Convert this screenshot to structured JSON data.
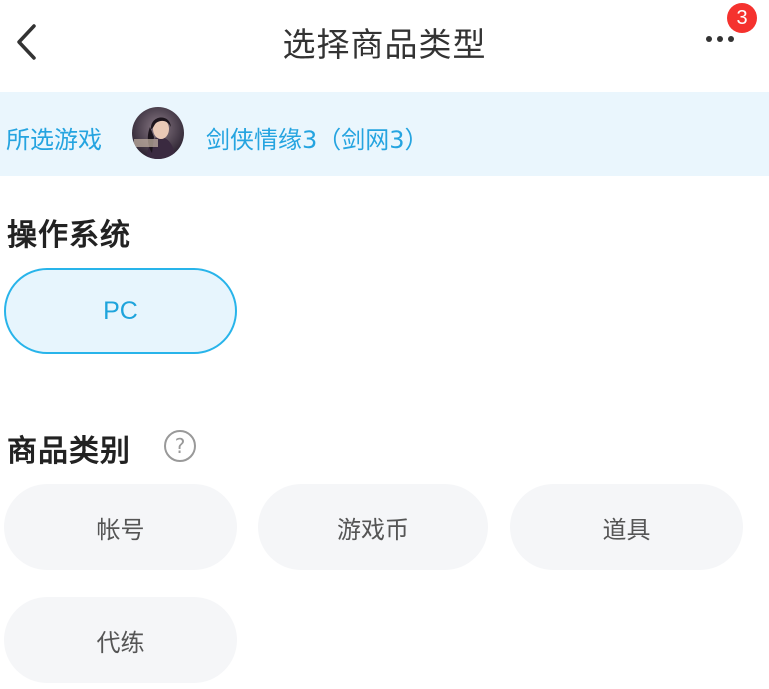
{
  "header": {
    "title": "选择商品类型",
    "badge_count": "3",
    "back_icon": "chevron-left-icon",
    "more_icon": "more-horizontal-icon"
  },
  "game": {
    "label": "所选游戏",
    "name": "剑侠情缘3（剑网3）"
  },
  "os_section": {
    "title": "操作系统",
    "options": [
      {
        "label": "PC",
        "selected": true
      }
    ]
  },
  "category_section": {
    "title": "商品类别",
    "help_icon": "question-circle-icon",
    "help_glyph": "?",
    "options": [
      {
        "label": "帐号"
      },
      {
        "label": "游戏币"
      },
      {
        "label": "道具"
      },
      {
        "label": "代练"
      }
    ]
  },
  "colors": {
    "accent": "#25a4e0",
    "selected_border": "#28b4ea",
    "selected_bg": "#e7f5fd",
    "game_bar_bg": "#eaf6fd",
    "pill_bg": "#f5f6f8",
    "badge": "#f5322e"
  }
}
